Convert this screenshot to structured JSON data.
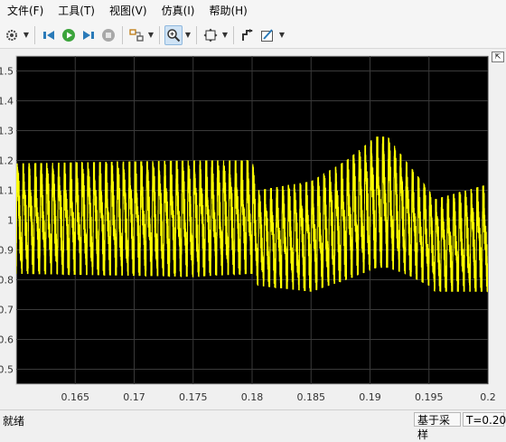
{
  "menu": [
    "文件(F)",
    "工具(T)",
    "视图(V)",
    "仿真(I)",
    "帮助(H)"
  ],
  "toolbar": {
    "icons": [
      "gear-icon",
      "step-back-icon",
      "run-icon",
      "step-forward-icon",
      "stop-icon",
      "highlight-block-icon",
      "zoom-icon",
      "fit-to-view-icon",
      "cursor-measure-icon",
      "style-icon"
    ]
  },
  "chart_data": {
    "type": "line",
    "title": "",
    "xlabel": "",
    "ylabel": "",
    "xlim": [
      0.16,
      0.2
    ],
    "ylim": [
      0.45,
      1.55
    ],
    "x_ticks": [
      "0.165",
      "0.17",
      "0.175",
      "0.18",
      "0.185",
      "0.19",
      "0.195",
      "0.2"
    ],
    "y_ticks": [
      "1.5",
      "1.4",
      "1.3",
      "1.2",
      "1.1",
      "1",
      "0.9",
      "0.8",
      "0.7",
      "0.6",
      "0.5"
    ],
    "grid": true,
    "background": "#000000",
    "series": [
      {
        "color": "#ffff00",
        "ripple_period": 0.0005,
        "envelope": {
          "x": [
            0.16,
            0.175,
            0.18,
            0.1805,
            0.185,
            0.188,
            0.1905,
            0.1915,
            0.193,
            0.195,
            0.1955,
            0.2
          ],
          "upper": [
            1.19,
            1.2,
            1.2,
            1.1,
            1.13,
            1.2,
            1.28,
            1.28,
            1.2,
            1.1,
            1.07,
            1.12
          ],
          "lower": [
            0.82,
            0.81,
            0.82,
            0.78,
            0.76,
            0.8,
            0.84,
            0.84,
            0.82,
            0.78,
            0.76,
            0.76
          ]
        }
      }
    ]
  },
  "status": {
    "left": "就绪",
    "mode": "基于采样",
    "time": "T=0.200"
  }
}
